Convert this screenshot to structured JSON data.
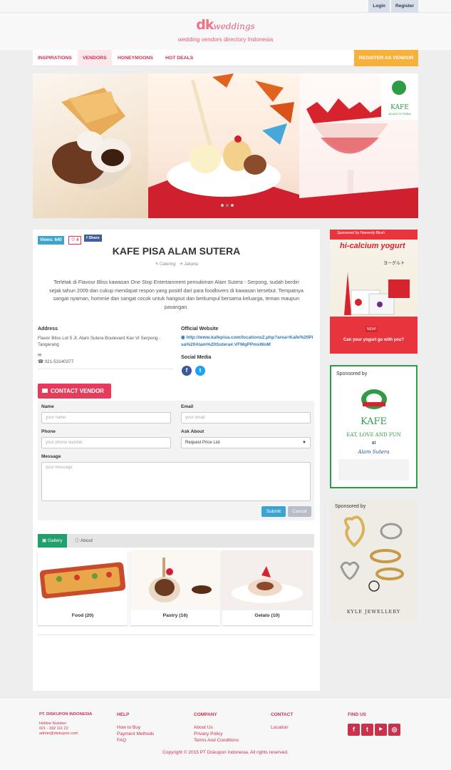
{
  "topbar": {
    "login": "Login",
    "register": "Register"
  },
  "brand": {
    "logo_dk": "dk",
    "logo_word": "weddings",
    "tagline": "wedding vendors directory Indonesia"
  },
  "nav": {
    "items": [
      "INSPIRATIONS",
      "VENDORS",
      "HONEYMOONS",
      "HOT DEALS"
    ],
    "active": "VENDORS",
    "cta": "REGISTER AS VENDOR"
  },
  "hero": {
    "logo_text": "KAFE",
    "logo_sub": "ALAM SUTERA"
  },
  "vendor": {
    "views": "Views: 640",
    "loves": "4",
    "share": "Share",
    "name": "KAFE PISA ALAM SUTERA",
    "category": "Catering",
    "city": "Jakarta",
    "description": "Terletak di Flavour Bliss kawasan One Stop Entertainment pemukiman Alam Sutera - Serpong, sudah berdiri sejak tahun 2009 dan cukup mendapat respon yang positif dari para foodlovers di kawasan tersebut. Tempatnya sangat nyaman, hommie dan sangat cocok untuk hangout dan berkumpul bersama keluarga, teman maupun pasangan.",
    "address_label": "Address",
    "address": "Flavor Bliss Lot 5 Jl. Alam Sutera Boulevard Kav VI Serpong - Tangerang",
    "phone": "021-53140377",
    "website_label": "Official Website",
    "website": "http://www.kafepisa.com/locations2.php?area=Kafe%20Pisa%20Alam%20Sutera#.VFMqPPmsWoM",
    "social_label": "Social Media"
  },
  "contact": {
    "button": "CONTACT VENDOR",
    "name_label": "Name",
    "name_placeholder": "your name",
    "email_label": "Email",
    "email_placeholder": "your email",
    "phone_label": "Phone",
    "phone_placeholder": "your phone number",
    "ask_label": "Ask About",
    "ask_value": "Request Price List",
    "message_label": "Message",
    "message_placeholder": "your message",
    "submit": "Submit",
    "cancel": "Cancel"
  },
  "tabs": {
    "gallery": "Gallery",
    "about": "About"
  },
  "gallery": [
    {
      "caption": "Food (20)"
    },
    {
      "caption": "Pastry (16)"
    },
    {
      "caption": "Gelato (10)"
    }
  ],
  "ads": [
    {
      "sponsor": "Sponsored by Heavenly Blush",
      "headline": "hi-calcium yogurt",
      "jp": "ヨーグルト",
      "tagline": "Can your yogurt go with you?",
      "badge": "NEW!"
    },
    {
      "sponsor": "Sponsored by",
      "brand": "KAFE",
      "tagline": "EAT, LOVE AND FUN",
      "at": "at",
      "place": "Alam Sutera"
    },
    {
      "sponsor": "Sponsored by",
      "brand": "KYLE JEWELLERY"
    }
  ],
  "footer": {
    "company": "PT. DISKUPON INDONESIA",
    "hotline_label": "Hotline Number",
    "hotline": "021 - 332 111 22",
    "email": "admin@diskupon.com",
    "help_title": "HELP",
    "help_links": [
      "How to Buy",
      "Payment Methods",
      "FAQ"
    ],
    "company_title": "COMPANY",
    "company_links": [
      "About Us",
      "Privacy Policy",
      "Terms And Conditions"
    ],
    "contact_title": "CONTACT",
    "contact_links": [
      "Location"
    ],
    "find_title": "FIND US",
    "copyright": "Copyright © 2015 PT Diskupon Indonesia. All rights reserved."
  },
  "colors": {
    "brand": "#c9324b",
    "accent_orange": "#f6b13b",
    "contact_red": "#e63c5c",
    "info_blue": "#3ba5cf",
    "tab_green": "#20a06e"
  },
  "icons": [
    "tag-icon",
    "plane-icon",
    "envelope-icon",
    "phone-icon",
    "globe-icon",
    "facebook-icon",
    "twitter-icon",
    "youtube-icon",
    "instagram-icon",
    "heart-icon",
    "image-icon",
    "info-icon"
  ]
}
